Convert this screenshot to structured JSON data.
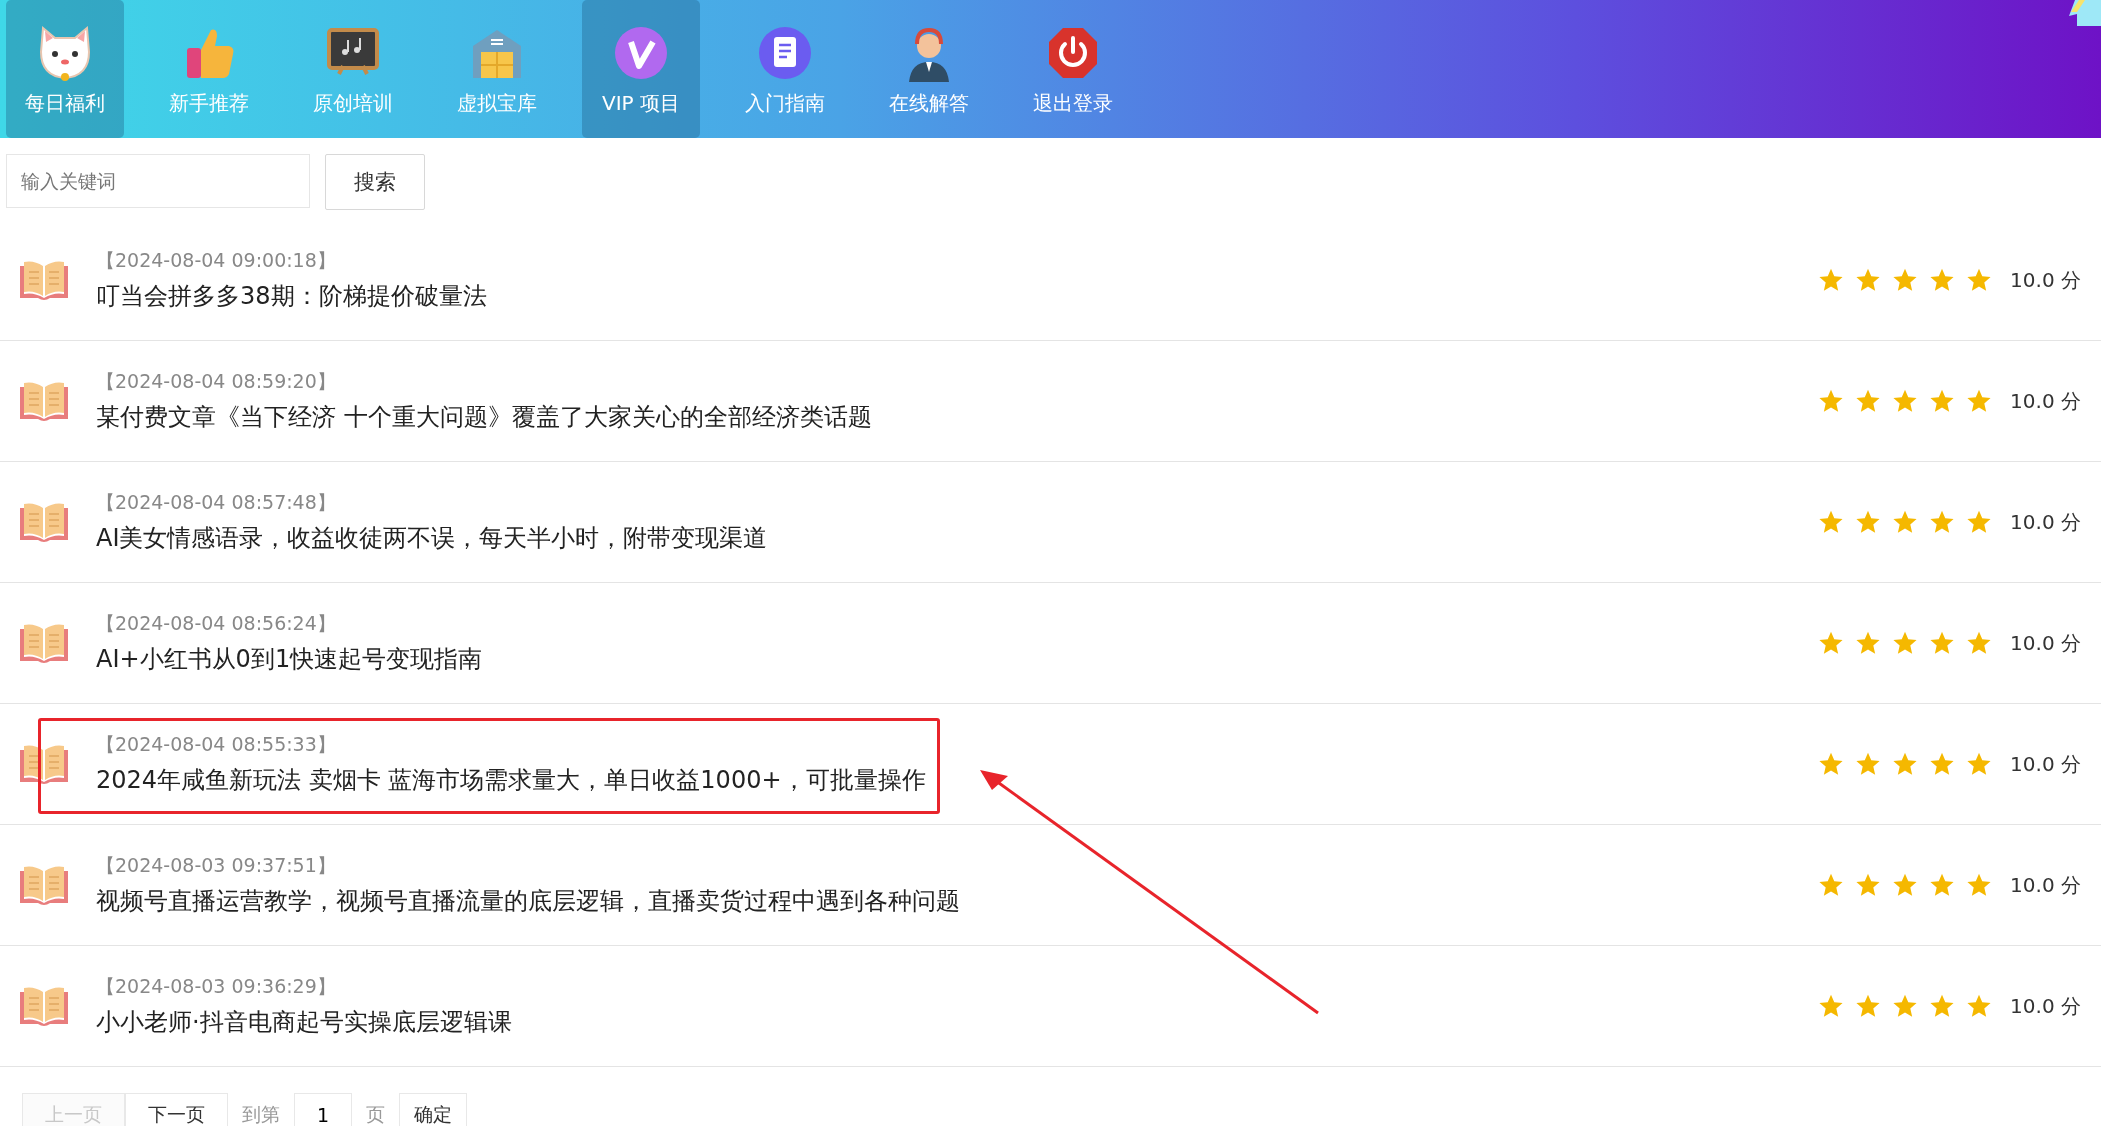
{
  "nav": {
    "items": [
      {
        "label": "每日福利",
        "selected": true
      },
      {
        "label": "新手推荐",
        "selected": false
      },
      {
        "label": "原创培训",
        "selected": false
      },
      {
        "label": "虚拟宝库",
        "selected": false
      },
      {
        "label": "VIP 项目",
        "selected": true
      },
      {
        "label": "入门指南",
        "selected": false
      },
      {
        "label": "在线解答",
        "selected": false
      },
      {
        "label": "退出登录",
        "selected": false
      }
    ]
  },
  "search": {
    "placeholder": "输入关键词",
    "button": "搜索"
  },
  "articles": [
    {
      "date": "【2024-08-04 09:00:18】",
      "title": "叮当会拼多多38期：阶梯提价破量法",
      "stars": 5,
      "score": "10.0 分",
      "highlighted": false
    },
    {
      "date": "【2024-08-04 08:59:20】",
      "title": "某付费文章《当下经济 十个重大问题》覆盖了大家关心的全部经济类话题",
      "stars": 5,
      "score": "10.0 分",
      "highlighted": false
    },
    {
      "date": "【2024-08-04 08:57:48】",
      "title": "AI美女情感语录，收益收徒两不误，每天半小时，附带变现渠道",
      "stars": 5,
      "score": "10.0 分",
      "highlighted": false
    },
    {
      "date": "【2024-08-04 08:56:24】",
      "title": "AI+小红书从0到1快速起号变现指南",
      "stars": 5,
      "score": "10.0 分",
      "highlighted": false
    },
    {
      "date": "【2024-08-04 08:55:33】",
      "title": "2024年咸鱼新玩法 卖烟卡 蓝海市场需求量大，单日收益1000+，可批量操作",
      "stars": 5,
      "score": "10.0 分",
      "highlighted": true
    },
    {
      "date": "【2024-08-03 09:37:51】",
      "title": "视频号直播运营教学，视频号直播流量的底层逻辑，直播卖货过程中遇到各种问题",
      "stars": 5,
      "score": "10.0 分",
      "highlighted": false
    },
    {
      "date": "【2024-08-03 09:36:29】",
      "title": "小小老师·抖音电商起号实操底层逻辑课",
      "stars": 5,
      "score": "10.0 分",
      "highlighted": false
    }
  ],
  "pagination": {
    "prev": {
      "label": "上一页",
      "disabled": true
    },
    "next": {
      "label": "下一页",
      "disabled": false
    },
    "goto_label": "到第",
    "page": "1",
    "page_suffix": "页",
    "confirm": "确定"
  }
}
